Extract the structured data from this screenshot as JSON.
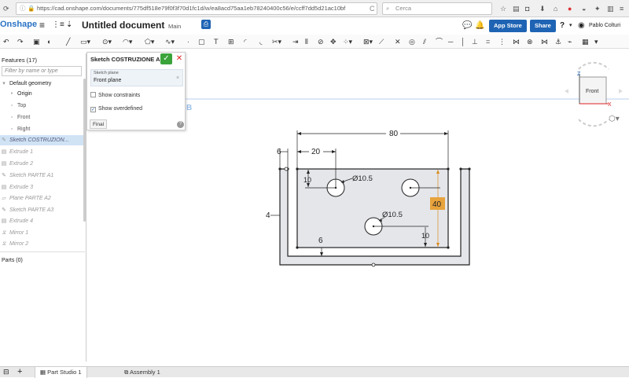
{
  "browser": {
    "url": "https://cad.onshape.com/documents/775df518e79f0f3f70d1fc1d/w/ea8acd75aa1eb78240400c56/e/ccff7dd5d21ac10bf",
    "search_placeholder": "Cerca"
  },
  "app": {
    "logo": "Onshape",
    "doc_title": "Untitled document",
    "branch": "Main",
    "app_store": "App Store",
    "share": "Share",
    "help": "?",
    "user": "Pablo Colturi"
  },
  "features": {
    "header": "Features (17)",
    "filter_placeholder": "Filter by name or type",
    "items": [
      {
        "label": "Default geometry",
        "icon": "caret-down-icon"
      },
      {
        "label": "Origin",
        "icon": "origin-icon"
      },
      {
        "label": "Top",
        "icon": "plane-icon"
      },
      {
        "label": "Front",
        "icon": "plane-icon"
      },
      {
        "label": "Right",
        "icon": "plane-icon"
      },
      {
        "label": "Sketch COSTRUZION...",
        "icon": "sketch-icon"
      },
      {
        "label": "Extrude 1",
        "icon": "extrude-icon"
      },
      {
        "label": "Extrude 2",
        "icon": "extrude-icon"
      },
      {
        "label": "Sketch PARTE A1",
        "icon": "sketch-icon"
      },
      {
        "label": "Extrude 3",
        "icon": "extrude-icon"
      },
      {
        "label": "Plane PARTE A2",
        "icon": "plane-icon"
      },
      {
        "label": "Sketch PARTE A3",
        "icon": "sketch-icon"
      },
      {
        "label": "Extrude 4",
        "icon": "extrude-icon"
      },
      {
        "label": "Mirror 1",
        "icon": "mirror-icon"
      },
      {
        "label": "Mirror 2",
        "icon": "mirror-icon"
      }
    ],
    "parts": "Parts (0)"
  },
  "sketch_panel": {
    "title": "Sketch COSTRUZIONE A ...",
    "plane_label": "Sketch plane",
    "plane_value": "Front plane",
    "show_constraints": "Show constraints",
    "show_overdefined": "Show overdefined",
    "final": "Final"
  },
  "viewcube": {
    "face": "Front",
    "z": "Z",
    "x": "X"
  },
  "canvas": {
    "dims": {
      "d80": "80",
      "d20": "20",
      "d6_top": "6",
      "d10_left": "10",
      "dia1": "Ø10.5",
      "dia2": "Ø10.5",
      "d40": "40",
      "d10_right": "10",
      "d4": "4",
      "d6_bottom": "6"
    },
    "label_b": "B"
  },
  "tabs": {
    "part_studio": "Part Studio 1",
    "assembly": "Assembly 1"
  },
  "colors": {
    "accent": "#1f64b4",
    "selected_dim": "#e8a33c",
    "sketch_fill": "#e4e6ea"
  }
}
